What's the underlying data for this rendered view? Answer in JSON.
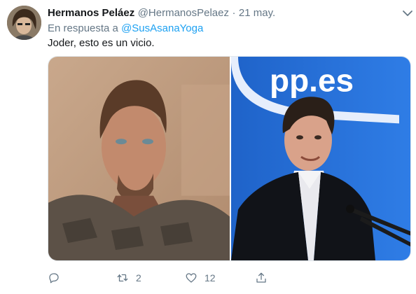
{
  "tweet": {
    "author_name": "Hermanos Peláez",
    "author_handle": "@HermanosPelaez",
    "separator": "·",
    "date": "21 may.",
    "reply_prefix": "En respuesta a",
    "reply_to": "@SusAsanaYoga",
    "text": "Joder, esto es un vicio."
  },
  "media": {
    "right_sign_text": "pp.es"
  },
  "actions": {
    "reply_count": "",
    "retweet_count": "2",
    "like_count": "12"
  },
  "colors": {
    "link": "#1da1f2",
    "muted": "#657786",
    "text": "#14171a"
  },
  "icons": {
    "menu": "chevron-down-icon",
    "reply": "reply-icon",
    "retweet": "retweet-icon",
    "like": "heart-icon",
    "share": "share-icon"
  }
}
